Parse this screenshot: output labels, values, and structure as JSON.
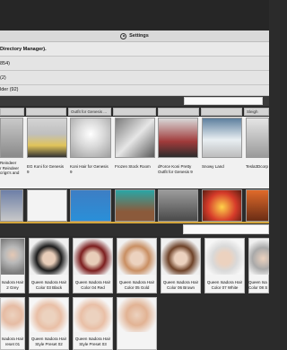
{
  "top_list": {
    "settings_label": "Settings",
    "rows": [
      "Directory Manager).",
      "854)",
      "(2)",
      "lder (92)"
    ]
  },
  "header_row": {
    "cells": [
      "",
      "",
      "Outfit for Genesis ...",
      "",
      "",
      "",
      "Sleigh"
    ]
  },
  "products_row1": [
    {
      "label_line1": "Reindeer",
      "label_line2": "r Reindeer",
      "label_line3": "crigs's and"
    },
    {
      "label_line1": "EG Koni for Genesis",
      "label_line2": "9",
      "label_line3": ""
    },
    {
      "label_line1": "Koni Hair for Genesis",
      "label_line2": "9",
      "label_line3": ""
    },
    {
      "label_line1": "Frozen Stock Room",
      "label_line2": "",
      "label_line3": ""
    },
    {
      "label_line1": "dForce Koni Pretty",
      "label_line2": "Outfit for Genesis 9",
      "label_line3": ""
    },
    {
      "label_line1": "Snowy Land",
      "label_line2": "",
      "label_line3": ""
    },
    {
      "label_line1": "Tesla3Dcorp",
      "label_line2": "",
      "label_line3": ""
    }
  ],
  "hair_row1": [
    {
      "line1": "Isadora Hair",
      "line2": "2 Grey"
    },
    {
      "line1": "Queen Isadora Hair",
      "line2": "Color 03 Black"
    },
    {
      "line1": "Queen Isadora Hair",
      "line2": "Color 04 Red"
    },
    {
      "line1": "Queen Isadora Hair",
      "line2": "Color 05 Gold"
    },
    {
      "line1": "Queen Isadora Hair",
      "line2": "Color 06 Brown"
    },
    {
      "line1": "Queen Isadora Hair",
      "line2": "Color 07 White"
    },
    {
      "line1": "Queen Isa",
      "line2": "Color 08 S"
    }
  ],
  "hair_row2": [
    {
      "line1": "Isadora Hair",
      "line2": "reset 01"
    },
    {
      "line1": "Queen Isadora Hair",
      "line2": "Style Preset 02"
    },
    {
      "line1": "Queen Isadora Hair",
      "line2": "Style Preset 03"
    }
  ],
  "colors": {
    "accent_gold": "#d4a63c",
    "page_dark": "#2b2b2b",
    "panel_light": "#e4e4e4"
  }
}
